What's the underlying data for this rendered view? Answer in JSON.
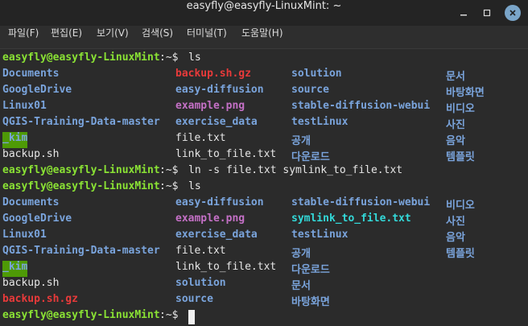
{
  "window": {
    "title": "easyfly@easyfly-LinuxMint: ~"
  },
  "menu": {
    "items": [
      "파일(F)",
      "편집(E)",
      "보기(V)",
      "검색(S)",
      "터미널(T)",
      "도움말(H)"
    ]
  },
  "terminal": {
    "prompt": "easyfly@easyfly-LinuxMint",
    "prompt_suffix": ":~$ ",
    "cmd1": "ls",
    "cmd2": "ln -s file.txt symlink_to_file.txt",
    "cmd3": "ls",
    "listing1": [
      [
        "Documents",
        "backup.sh.gz",
        "solution",
        "문서"
      ],
      [
        "GoogleDrive",
        "easy-diffusion",
        "source",
        "바탕화면"
      ],
      [
        "Linux01",
        "example.png",
        "stable-diffusion-webui",
        "비디오"
      ],
      [
        "QGIS-Training-Data-master",
        "exercise_data",
        "testLinux",
        "사진"
      ],
      [
        "_kim",
        "file.txt",
        "공개",
        "음악"
      ],
      [
        "backup.sh",
        "link_to_file.txt",
        "다운로드",
        "템플릿"
      ]
    ],
    "listing2": [
      [
        "Documents",
        "easy-diffusion",
        "stable-diffusion-webui",
        "비디오"
      ],
      [
        "GoogleDrive",
        "example.png",
        "symlink_to_file.txt",
        "사진"
      ],
      [
        "Linux01",
        "exercise_data",
        "testLinux",
        "음악"
      ],
      [
        "QGIS-Training-Data-master",
        "file.txt",
        "공개",
        "템플릿"
      ],
      [
        "_kim",
        "link_to_file.txt",
        "다운로드",
        ""
      ],
      [
        "backup.sh",
        "solution",
        "문서",
        ""
      ],
      [
        "backup.sh.gz",
        "source",
        "바탕화면",
        ""
      ]
    ],
    "colors": {
      "prompt": "#8ae234",
      "directory": "#7aa4dc",
      "image": "#c470c6",
      "archive": "#e83a3a",
      "symlink": "#33d9d9",
      "plain": "#e6e6e6"
    }
  }
}
